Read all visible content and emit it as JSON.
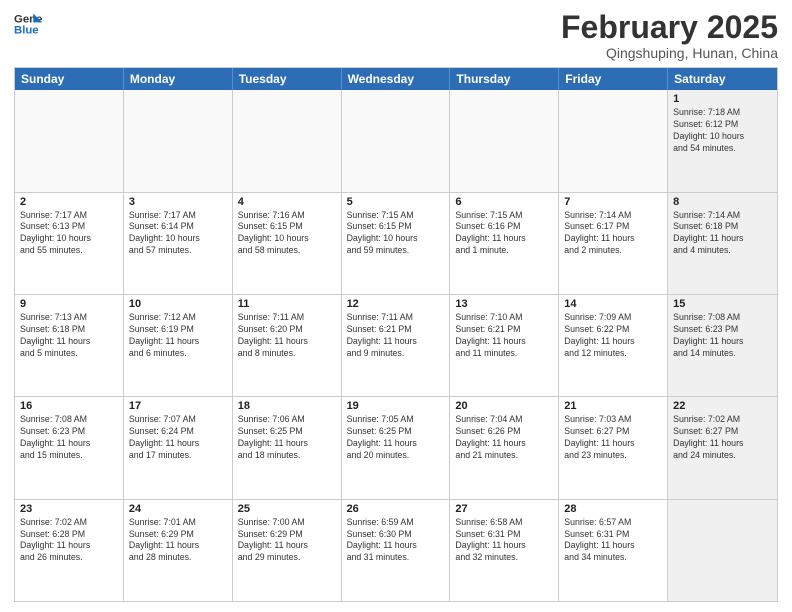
{
  "header": {
    "logo_line1": "General",
    "logo_line2": "Blue",
    "month_title": "February 2025",
    "location": "Qingshuping, Hunan, China"
  },
  "weekdays": [
    "Sunday",
    "Monday",
    "Tuesday",
    "Wednesday",
    "Thursday",
    "Friday",
    "Saturday"
  ],
  "rows": [
    [
      {
        "day": "",
        "info": "",
        "shaded": false,
        "empty": true
      },
      {
        "day": "",
        "info": "",
        "shaded": false,
        "empty": true
      },
      {
        "day": "",
        "info": "",
        "shaded": false,
        "empty": true
      },
      {
        "day": "",
        "info": "",
        "shaded": false,
        "empty": true
      },
      {
        "day": "",
        "info": "",
        "shaded": false,
        "empty": true
      },
      {
        "day": "",
        "info": "",
        "shaded": false,
        "empty": true
      },
      {
        "day": "1",
        "info": "Sunrise: 7:18 AM\nSunset: 6:12 PM\nDaylight: 10 hours\nand 54 minutes.",
        "shaded": true,
        "empty": false
      }
    ],
    [
      {
        "day": "2",
        "info": "Sunrise: 7:17 AM\nSunset: 6:13 PM\nDaylight: 10 hours\nand 55 minutes.",
        "shaded": false,
        "empty": false
      },
      {
        "day": "3",
        "info": "Sunrise: 7:17 AM\nSunset: 6:14 PM\nDaylight: 10 hours\nand 57 minutes.",
        "shaded": false,
        "empty": false
      },
      {
        "day": "4",
        "info": "Sunrise: 7:16 AM\nSunset: 6:15 PM\nDaylight: 10 hours\nand 58 minutes.",
        "shaded": false,
        "empty": false
      },
      {
        "day": "5",
        "info": "Sunrise: 7:15 AM\nSunset: 6:15 PM\nDaylight: 10 hours\nand 59 minutes.",
        "shaded": false,
        "empty": false
      },
      {
        "day": "6",
        "info": "Sunrise: 7:15 AM\nSunset: 6:16 PM\nDaylight: 11 hours\nand 1 minute.",
        "shaded": false,
        "empty": false
      },
      {
        "day": "7",
        "info": "Sunrise: 7:14 AM\nSunset: 6:17 PM\nDaylight: 11 hours\nand 2 minutes.",
        "shaded": false,
        "empty": false
      },
      {
        "day": "8",
        "info": "Sunrise: 7:14 AM\nSunset: 6:18 PM\nDaylight: 11 hours\nand 4 minutes.",
        "shaded": true,
        "empty": false
      }
    ],
    [
      {
        "day": "9",
        "info": "Sunrise: 7:13 AM\nSunset: 6:18 PM\nDaylight: 11 hours\nand 5 minutes.",
        "shaded": false,
        "empty": false
      },
      {
        "day": "10",
        "info": "Sunrise: 7:12 AM\nSunset: 6:19 PM\nDaylight: 11 hours\nand 6 minutes.",
        "shaded": false,
        "empty": false
      },
      {
        "day": "11",
        "info": "Sunrise: 7:11 AM\nSunset: 6:20 PM\nDaylight: 11 hours\nand 8 minutes.",
        "shaded": false,
        "empty": false
      },
      {
        "day": "12",
        "info": "Sunrise: 7:11 AM\nSunset: 6:21 PM\nDaylight: 11 hours\nand 9 minutes.",
        "shaded": false,
        "empty": false
      },
      {
        "day": "13",
        "info": "Sunrise: 7:10 AM\nSunset: 6:21 PM\nDaylight: 11 hours\nand 11 minutes.",
        "shaded": false,
        "empty": false
      },
      {
        "day": "14",
        "info": "Sunrise: 7:09 AM\nSunset: 6:22 PM\nDaylight: 11 hours\nand 12 minutes.",
        "shaded": false,
        "empty": false
      },
      {
        "day": "15",
        "info": "Sunrise: 7:08 AM\nSunset: 6:23 PM\nDaylight: 11 hours\nand 14 minutes.",
        "shaded": true,
        "empty": false
      }
    ],
    [
      {
        "day": "16",
        "info": "Sunrise: 7:08 AM\nSunset: 6:23 PM\nDaylight: 11 hours\nand 15 minutes.",
        "shaded": false,
        "empty": false
      },
      {
        "day": "17",
        "info": "Sunrise: 7:07 AM\nSunset: 6:24 PM\nDaylight: 11 hours\nand 17 minutes.",
        "shaded": false,
        "empty": false
      },
      {
        "day": "18",
        "info": "Sunrise: 7:06 AM\nSunset: 6:25 PM\nDaylight: 11 hours\nand 18 minutes.",
        "shaded": false,
        "empty": false
      },
      {
        "day": "19",
        "info": "Sunrise: 7:05 AM\nSunset: 6:25 PM\nDaylight: 11 hours\nand 20 minutes.",
        "shaded": false,
        "empty": false
      },
      {
        "day": "20",
        "info": "Sunrise: 7:04 AM\nSunset: 6:26 PM\nDaylight: 11 hours\nand 21 minutes.",
        "shaded": false,
        "empty": false
      },
      {
        "day": "21",
        "info": "Sunrise: 7:03 AM\nSunset: 6:27 PM\nDaylight: 11 hours\nand 23 minutes.",
        "shaded": false,
        "empty": false
      },
      {
        "day": "22",
        "info": "Sunrise: 7:02 AM\nSunset: 6:27 PM\nDaylight: 11 hours\nand 24 minutes.",
        "shaded": true,
        "empty": false
      }
    ],
    [
      {
        "day": "23",
        "info": "Sunrise: 7:02 AM\nSunset: 6:28 PM\nDaylight: 11 hours\nand 26 minutes.",
        "shaded": false,
        "empty": false
      },
      {
        "day": "24",
        "info": "Sunrise: 7:01 AM\nSunset: 6:29 PM\nDaylight: 11 hours\nand 28 minutes.",
        "shaded": false,
        "empty": false
      },
      {
        "day": "25",
        "info": "Sunrise: 7:00 AM\nSunset: 6:29 PM\nDaylight: 11 hours\nand 29 minutes.",
        "shaded": false,
        "empty": false
      },
      {
        "day": "26",
        "info": "Sunrise: 6:59 AM\nSunset: 6:30 PM\nDaylight: 11 hours\nand 31 minutes.",
        "shaded": false,
        "empty": false
      },
      {
        "day": "27",
        "info": "Sunrise: 6:58 AM\nSunset: 6:31 PM\nDaylight: 11 hours\nand 32 minutes.",
        "shaded": false,
        "empty": false
      },
      {
        "day": "28",
        "info": "Sunrise: 6:57 AM\nSunset: 6:31 PM\nDaylight: 11 hours\nand 34 minutes.",
        "shaded": false,
        "empty": false
      },
      {
        "day": "",
        "info": "",
        "shaded": true,
        "empty": true
      }
    ]
  ]
}
